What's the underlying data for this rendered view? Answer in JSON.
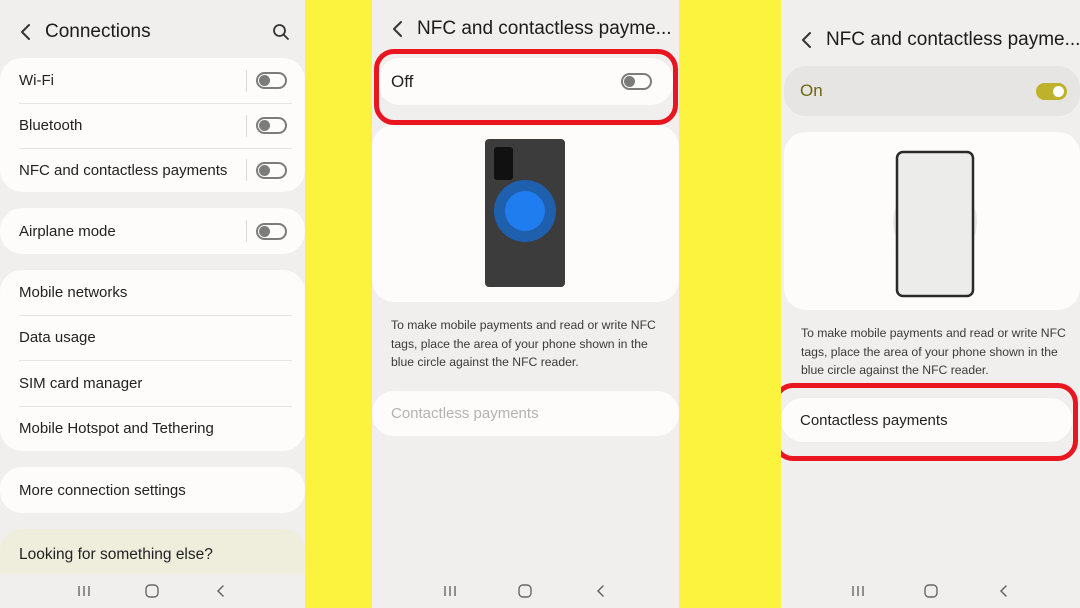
{
  "screen1": {
    "title": "Connections",
    "groups": [
      {
        "items": [
          {
            "label": "Wi-Fi",
            "toggle": "off"
          },
          {
            "label": "Bluetooth",
            "toggle": "off"
          },
          {
            "label": "NFC and contactless payments",
            "toggle": "off"
          }
        ]
      },
      {
        "items": [
          {
            "label": "Airplane mode",
            "toggle": "off"
          }
        ]
      },
      {
        "items": [
          {
            "label": "Mobile networks"
          },
          {
            "label": "Data usage"
          },
          {
            "label": "SIM card manager"
          },
          {
            "label": "Mobile Hotspot and Tethering"
          }
        ]
      },
      {
        "items": [
          {
            "label": "More connection settings"
          }
        ]
      }
    ],
    "suggestion": "Looking for something else?"
  },
  "screen2": {
    "title": "NFC and contactless payme...",
    "master_switch": {
      "label": "Off",
      "state": "off"
    },
    "description": "To make mobile payments and read or write NFC tags, place the area of your phone shown in the blue circle against the NFC reader.",
    "contactless": {
      "label": "Contactless payments",
      "enabled": false
    }
  },
  "screen3": {
    "title": "NFC and contactless payme...",
    "master_switch": {
      "label": "On",
      "state": "on"
    },
    "description": "To make mobile payments and read or write NFC tags, place the area of your phone shown in the blue circle against the NFC reader.",
    "contactless": {
      "label": "Contactless payments",
      "enabled": true
    }
  },
  "colors": {
    "backdrop": "#fbf33e",
    "screen_bg": "#f1efed",
    "card_bg": "#fdfcfb",
    "highlight_red": "#e9161f",
    "accent_on": "#bdb22a",
    "nfc_blue": "#1f7df0"
  },
  "icons": {
    "back": "chevron-left-icon",
    "search": "search-icon",
    "nav_recents": "recents-icon",
    "nav_home": "home-icon",
    "nav_back": "back-nav-icon"
  }
}
